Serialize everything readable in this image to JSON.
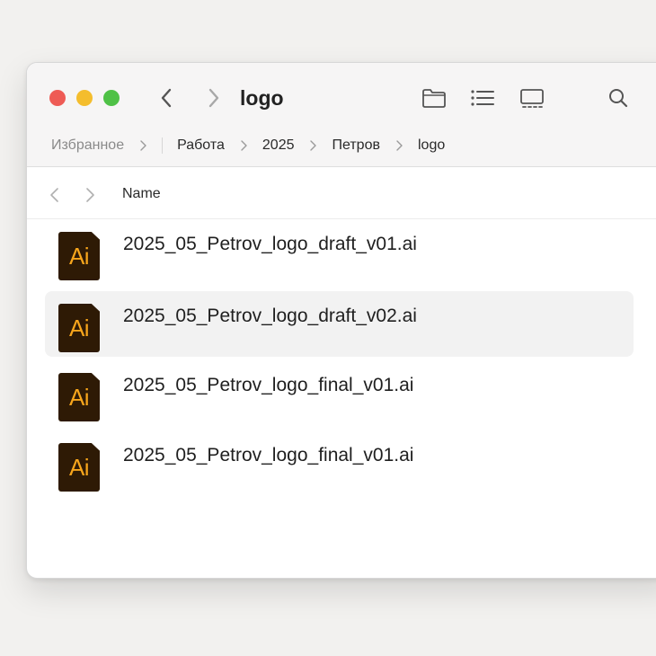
{
  "window": {
    "title": "logo"
  },
  "toolbar": {
    "back_icon": "chevron-left-icon",
    "forward_icon": "chevron-right-icon",
    "view_icons": [
      "folder-icon",
      "list-view-icon",
      "gallery-view-icon"
    ],
    "search_icon": "search-icon"
  },
  "breadcrumb": {
    "items": [
      "Избранное",
      "Работа",
      "2025",
      "Петров",
      "logo"
    ]
  },
  "columns": {
    "name": "Name"
  },
  "files": [
    {
      "name": "2025_05_Petrov_logo_draft_v01.ai",
      "icon_label": "Ai",
      "selected": false
    },
    {
      "name": "2025_05_Petrov_logo_draft_v02.ai",
      "icon_label": "Ai",
      "selected": true
    },
    {
      "name": "2025_05_Petrov_logo_final_v01.ai",
      "icon_label": "Ai",
      "selected": false
    },
    {
      "name": "2025_05_Petrov_logo_final_v01.ai",
      "icon_label": "Ai",
      "selected": false
    }
  ],
  "colors": {
    "ai_icon_bg": "#2e1a05",
    "ai_icon_text": "#f7a51c",
    "close": "#ee5b55",
    "minimize": "#f4bd2d",
    "zoom": "#4fc146"
  }
}
